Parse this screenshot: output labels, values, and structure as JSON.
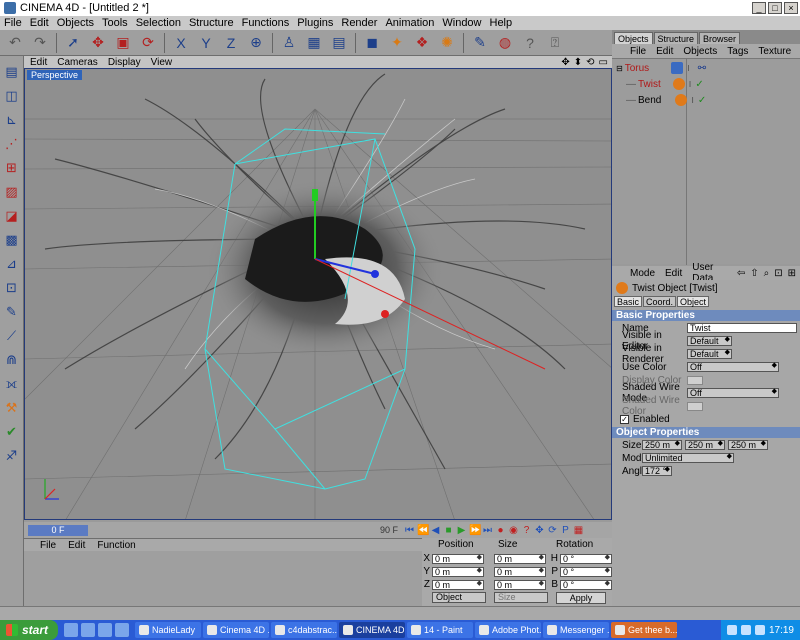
{
  "window": {
    "title": "CINEMA 4D - [Untitled 2 *]",
    "buttons": [
      "_",
      "□",
      "×"
    ]
  },
  "menubar": [
    "File",
    "Edit",
    "Objects",
    "Tools",
    "Selection",
    "Structure",
    "Functions",
    "Plugins",
    "Render",
    "Animation",
    "Window",
    "Help"
  ],
  "toolbar": {
    "axis_x": "X",
    "axis_y": "Y",
    "axis_z": "Z"
  },
  "viewport": {
    "menu": [
      "Edit",
      "Cameras",
      "Display",
      "View"
    ],
    "label": "Perspective"
  },
  "timeline": {
    "current_frame": "0 F",
    "end_frame": "90 F"
  },
  "material_manager": {
    "menu": [
      "File",
      "Edit",
      "Function"
    ]
  },
  "coordinates": {
    "headers": {
      "position": "Position",
      "size": "Size",
      "rotation": "Rotation"
    },
    "rows": [
      {
        "axis": "X",
        "pos": "0 m",
        "size": "0 m",
        "rot_axis": "H",
        "rot": "0 °"
      },
      {
        "axis": "Y",
        "pos": "0 m",
        "size": "0 m",
        "rot_axis": "P",
        "rot": "0 °"
      },
      {
        "axis": "Z",
        "pos": "0 m",
        "size": "0 m",
        "rot_axis": "B",
        "rot": "0 °"
      }
    ],
    "mode_select": "Object",
    "size_select": "Size",
    "apply_label": "Apply"
  },
  "object_manager": {
    "tabs": [
      "Objects",
      "Structure",
      "Browser"
    ],
    "menu": [
      "File",
      "Edit",
      "Objects",
      "Tags",
      "Texture"
    ],
    "items": [
      {
        "name": "Torus"
      },
      {
        "name": "Twist"
      },
      {
        "name": "Bend"
      }
    ]
  },
  "attributes": {
    "menu": [
      "Mode",
      "Edit",
      "User Data"
    ],
    "title": "Twist Object [Twist]",
    "tabs": [
      "Basic",
      "Coord.",
      "Object"
    ],
    "basic_section": "Basic Properties",
    "fields": {
      "name_label": "Name",
      "name_value": "Twist",
      "vis_editor_label": "Visible in Editor",
      "vis_editor_value": "Default",
      "vis_render_label": "Visible in Renderer",
      "vis_render_value": "Default",
      "use_color_label": "Use Color",
      "use_color_value": "Off",
      "display_color_label": "Display Color",
      "shaded_wire_mode_label": "Shaded Wire Mode",
      "shaded_wire_mode_value": "Off",
      "shaded_wire_color_label": "Shaded Wire Color",
      "enabled_label": "Enabled",
      "enabled_check": "✓"
    },
    "object_section": "Object Properties",
    "object_fields": {
      "size_label": "Size",
      "size_x": "250 m",
      "size_y": "250 m",
      "size_z": "250 m",
      "mode_label": "Mode",
      "mode_value": "Unlimited",
      "angle_label": "Angle",
      "angle_value": "172 °"
    }
  },
  "taskbar": {
    "start": "start",
    "tasks": [
      {
        "label": "NadieLady"
      },
      {
        "label": "Cinema 4D ..."
      },
      {
        "label": "c4dabstrac..."
      },
      {
        "label": "CINEMA 4D..."
      },
      {
        "label": "14 - Paint"
      },
      {
        "label": "Adobe Phot..."
      },
      {
        "label": "Messenger ..."
      },
      {
        "label": "Get thee b..."
      }
    ],
    "clock": "17:19"
  }
}
